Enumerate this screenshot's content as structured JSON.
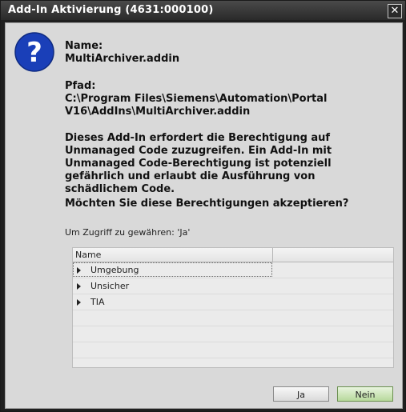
{
  "window": {
    "title": "Add-In Aktivierung (4631:000100)",
    "close_glyph": "✕"
  },
  "icon": {
    "name": "question-icon",
    "glyph": "?",
    "color": "#1a3fb8"
  },
  "message": {
    "name_label": "Name:",
    "name_value": "MultiArchiver.addin",
    "path_label": "Pfad:",
    "path_value": "C:\\Program Files\\Siemens\\Automation\\Portal V16\\AddIns\\MultiArchiver.addin",
    "description": "Dieses Add-In erfordert die Berechtigung auf Unmanaged Code zuzugreifen. Ein Add-In mit Unmanaged Code-Berechtigung ist potenziell gefährlich und erlaubt die Ausführung von schädlichem Code.",
    "question": "Möchten Sie diese Berechtigungen akzeptieren?"
  },
  "access_hint": "Um Zugriff zu gewähren: 'Ja'",
  "grid": {
    "column_header": "Name",
    "rows": [
      {
        "label": "Umgebung",
        "selected": true
      },
      {
        "label": "Unsicher",
        "selected": false
      },
      {
        "label": "TIA",
        "selected": false
      }
    ]
  },
  "buttons": {
    "yes": "Ja",
    "no": "Nein"
  }
}
